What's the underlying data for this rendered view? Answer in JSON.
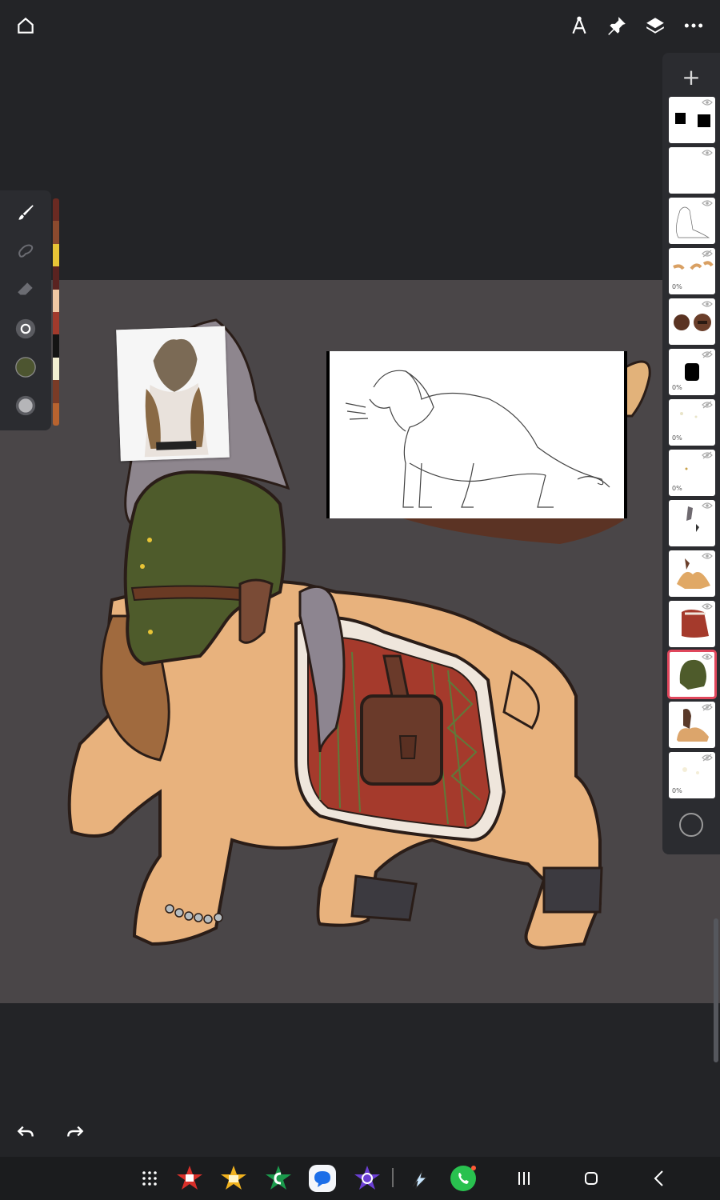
{
  "topbar": {
    "icons": [
      "home-icon",
      "ruler-compass-icon",
      "pin-icon",
      "layers-icon",
      "more-icon"
    ]
  },
  "toolbar": {
    "tools": [
      "brush-icon",
      "smudge-icon",
      "eraser-icon",
      "brush-size-icon",
      "current-color-icon",
      "opacity-icon"
    ],
    "current_color": "#4d5530",
    "swatches": [
      "#6a2a22",
      "#8b4a2e",
      "#e8c436",
      "#5a2320",
      "#f2c9a3",
      "#a13a2c",
      "#141414",
      "#f3efd2",
      "#7a3b26",
      "#b8632f"
    ]
  },
  "layers": {
    "add_label": "+",
    "items": [
      {
        "name": "layer-1",
        "visible": true,
        "opacity": ""
      },
      {
        "name": "layer-2",
        "visible": true,
        "opacity": ""
      },
      {
        "name": "layer-3",
        "visible": true,
        "opacity": ""
      },
      {
        "name": "layer-4",
        "visible": false,
        "opacity": "0%"
      },
      {
        "name": "layer-5",
        "visible": true,
        "opacity": ""
      },
      {
        "name": "layer-6",
        "visible": false,
        "opacity": "0%"
      },
      {
        "name": "layer-7",
        "visible": false,
        "opacity": "0%"
      },
      {
        "name": "layer-8",
        "visible": false,
        "opacity": "0%"
      },
      {
        "name": "layer-9",
        "visible": true,
        "opacity": ""
      },
      {
        "name": "layer-10",
        "visible": true,
        "opacity": ""
      },
      {
        "name": "layer-11",
        "visible": true,
        "opacity": ""
      },
      {
        "name": "layer-12",
        "visible": true,
        "opacity": "",
        "selected": true
      },
      {
        "name": "layer-13",
        "visible": false,
        "opacity": ""
      },
      {
        "name": "layer-14",
        "visible": false,
        "opacity": "0%"
      }
    ]
  },
  "colors": {
    "background": "#232427",
    "canvas": "#4a4648",
    "panel": "#2b2c30",
    "selected_layer": "#e0475c"
  },
  "bottom_nav": {
    "apps": [
      "app-drawer-icon",
      "red-star-app-icon",
      "yellow-star-app-icon",
      "green-star-app-icon",
      "messages-app-icon",
      "purple-app-icon",
      "bolt-app-icon",
      "whatsapp-app-icon"
    ],
    "system": [
      "recents-icon",
      "home-button-icon",
      "back-icon"
    ]
  }
}
